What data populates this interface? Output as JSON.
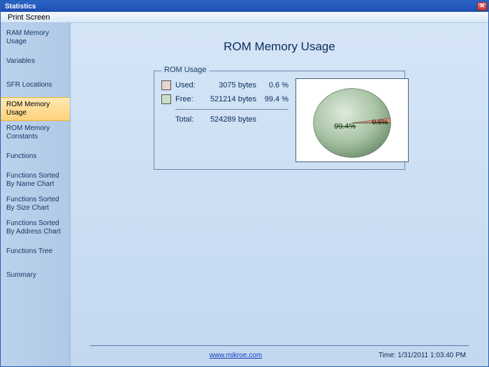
{
  "window": {
    "title": "Statistics"
  },
  "menu": {
    "print_screen": "Print Screen"
  },
  "sidebar": {
    "items": [
      {
        "label": "RAM Memory Usage"
      },
      {
        "label": "Variables"
      },
      {
        "label": "SFR Locations"
      },
      {
        "label": "ROM Memory Usage"
      },
      {
        "label": "ROM Memory Constants"
      },
      {
        "label": "Functions"
      },
      {
        "label": "Functions Sorted By Name Chart"
      },
      {
        "label": "Functions Sorted By Size Chart"
      },
      {
        "label": "Functions Sorted By Address Chart"
      },
      {
        "label": "Functions Tree"
      },
      {
        "label": "Summary"
      }
    ],
    "selected_index": 3
  },
  "page": {
    "title": "ROM Memory  Usage"
  },
  "group": {
    "label": "ROM Usage",
    "used_label": "Used:",
    "used_bytes": "3075 bytes",
    "used_pct": "0.6 %",
    "free_label": "Free:",
    "free_bytes": "521214 bytes",
    "free_pct": "99.4 %",
    "total_label": "Total:",
    "total_bytes": "524289 bytes"
  },
  "footer": {
    "link_text": "www.mikroe.com",
    "time_label": "Time: 1/31/2011 1:03:40 PM"
  },
  "chart_data": {
    "type": "pie",
    "title": "ROM Usage",
    "series": [
      {
        "name": "Used",
        "value": 3075,
        "pct": 0.6,
        "color": "#e7d3c9",
        "label": "0.6%"
      },
      {
        "name": "Free",
        "value": 521214,
        "pct": 99.4,
        "color": "#c6e0c6",
        "label": "99.4%"
      }
    ],
    "total": 524289
  }
}
